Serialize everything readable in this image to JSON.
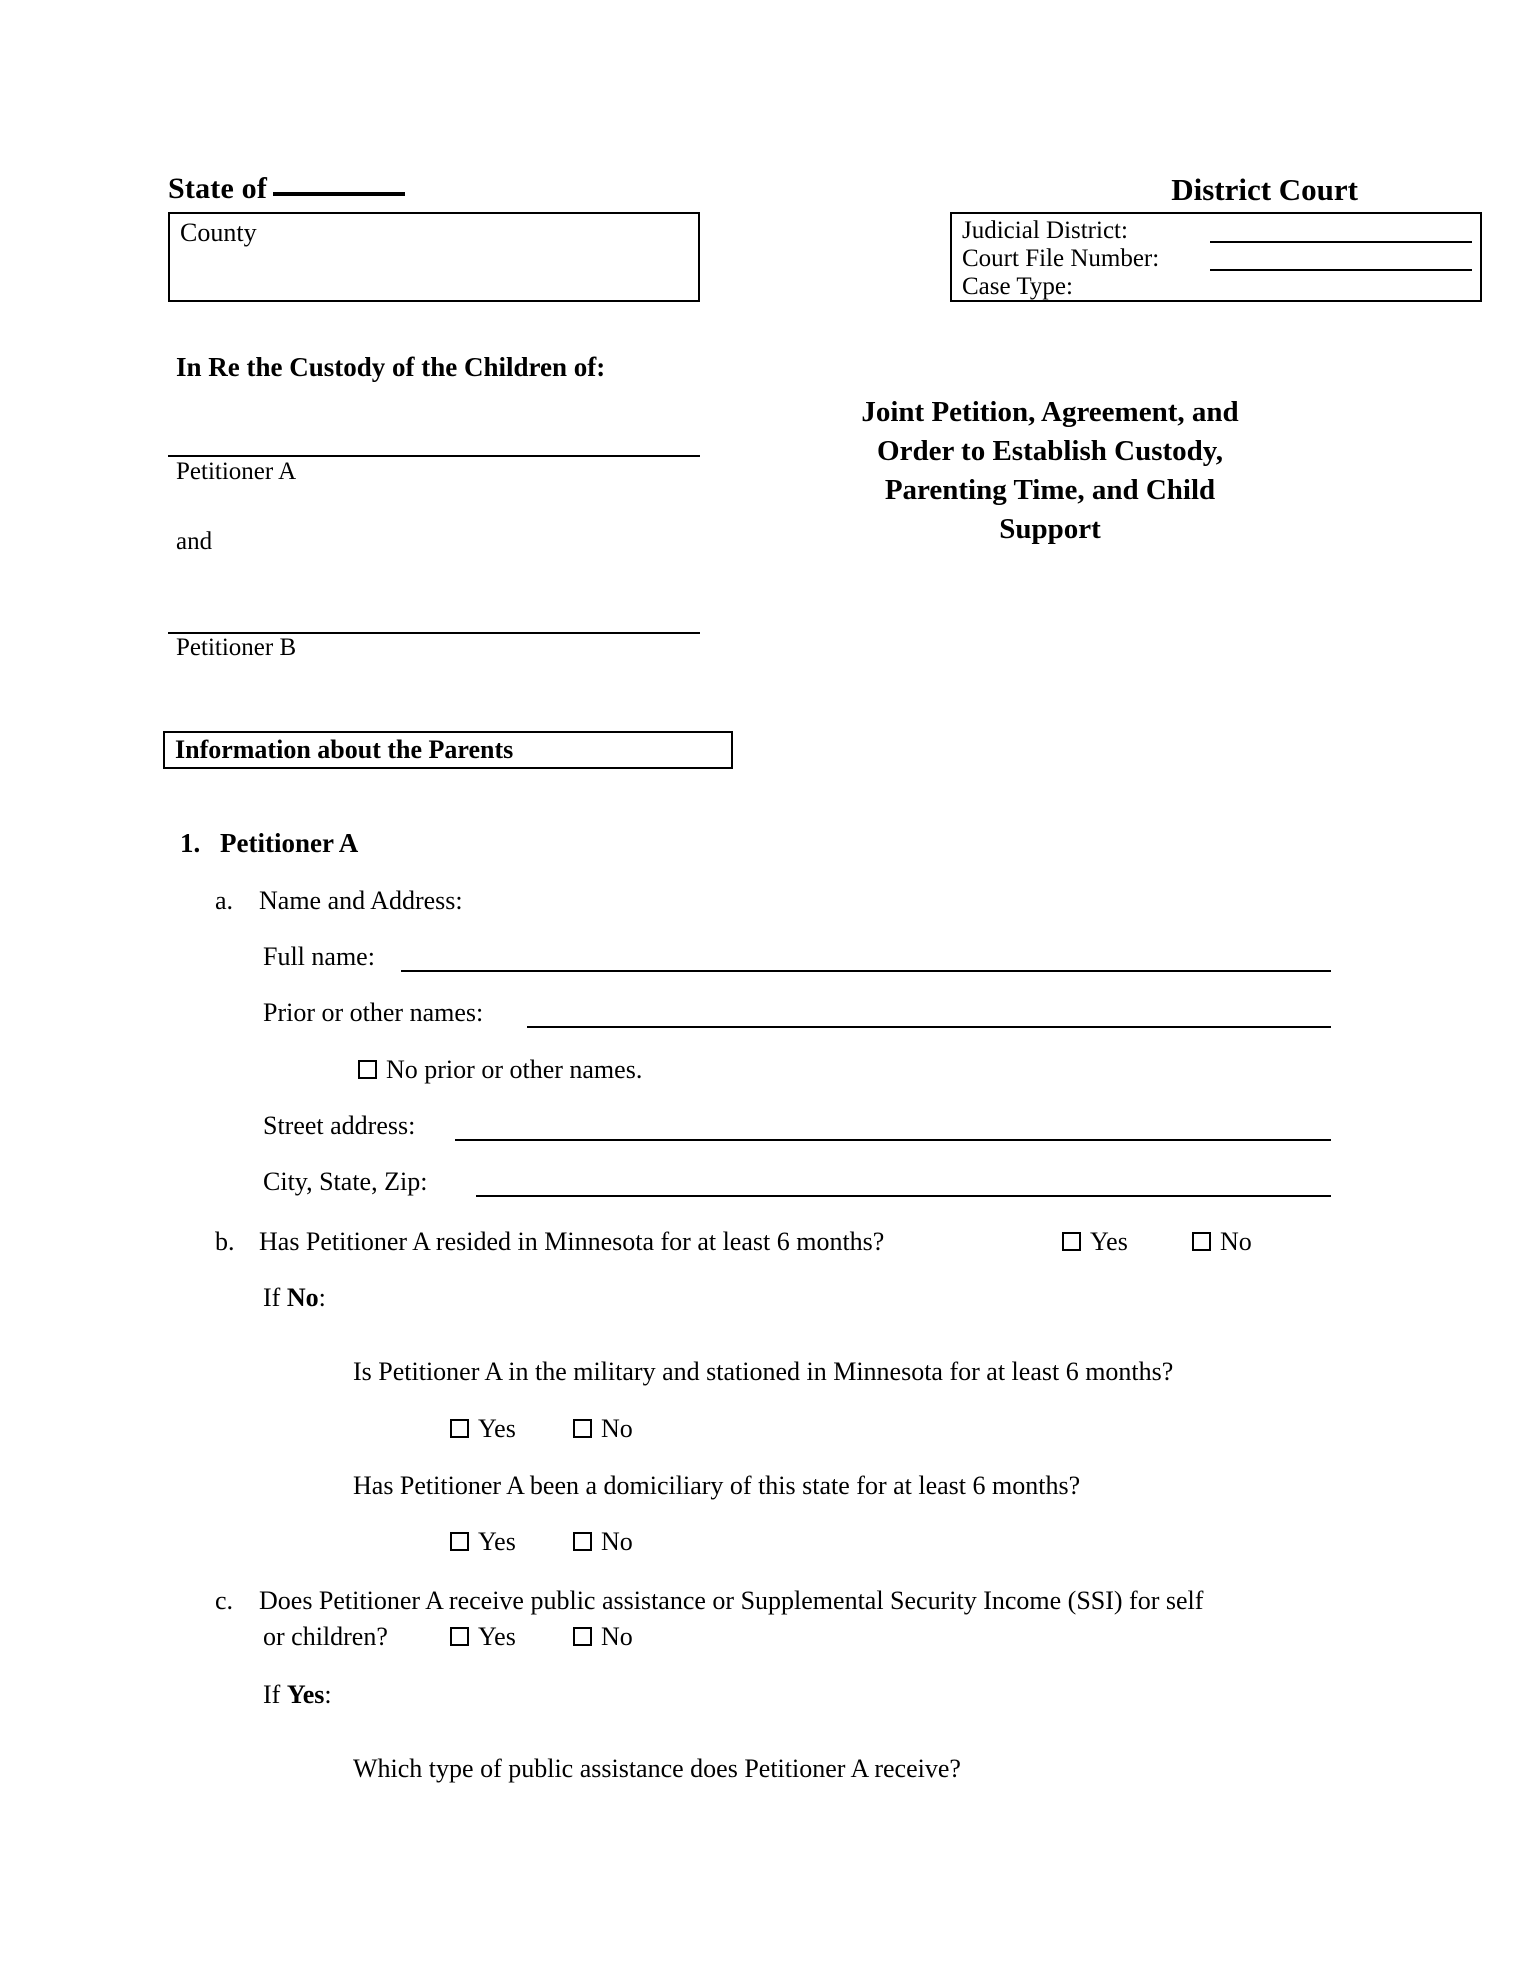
{
  "header": {
    "state_of_label": "State of",
    "county_label": "County",
    "district_court_title": "District Court",
    "court_fields": [
      {
        "label": "Judicial District:"
      },
      {
        "label": "Court File Number:"
      },
      {
        "label": "Case Type:"
      }
    ]
  },
  "caption": {
    "in_re": "In Re the Custody of the Children of:",
    "petitioner_a_label": "Petitioner A",
    "and_label": "and",
    "petitioner_b_label": "Petitioner B",
    "document_title_lines": [
      "Joint Petition, Agreement, and",
      "Order to Establish Custody,",
      "Parenting Time, and Child",
      "Support"
    ]
  },
  "section": {
    "heading": "Information about the Parents"
  },
  "items": {
    "item1_marker": "1.",
    "item1_title": "Petitioner A",
    "item_a_marker": "a.",
    "item_a_title": "Name and Address:",
    "full_name_label": "Full name:",
    "prior_names_label": "Prior or other names:",
    "no_prior_names_label": "No prior or other names.",
    "street_address_label": "Street address:",
    "city_state_zip_label": "City, State, Zip:",
    "item_b_marker": "b.",
    "item_b_question": "Has Petitioner A resided in Minnesota for at least 6 months?",
    "item_b_if_no_prefix": "If ",
    "item_b_if_no_bold": "No",
    "item_b_if_no_suffix": ":",
    "military_question": "Is Petitioner A in the military and stationed in Minnesota for at least 6 months?",
    "domiciliary_question": "Has Petitioner A been a domiciliary of this state for at least 6 months?",
    "item_c_marker": "c.",
    "item_c_question_line1": "Does Petitioner A receive public assistance or Supplemental Security Income (SSI) for self",
    "item_c_question_line2": "or children?",
    "item_c_if_yes_prefix": "If ",
    "item_c_if_yes_bold": "Yes",
    "item_c_if_yes_suffix": ":",
    "which_type_question": "Which type of public assistance does Petitioner A receive?",
    "yes_label": "Yes",
    "no_label": "No"
  }
}
